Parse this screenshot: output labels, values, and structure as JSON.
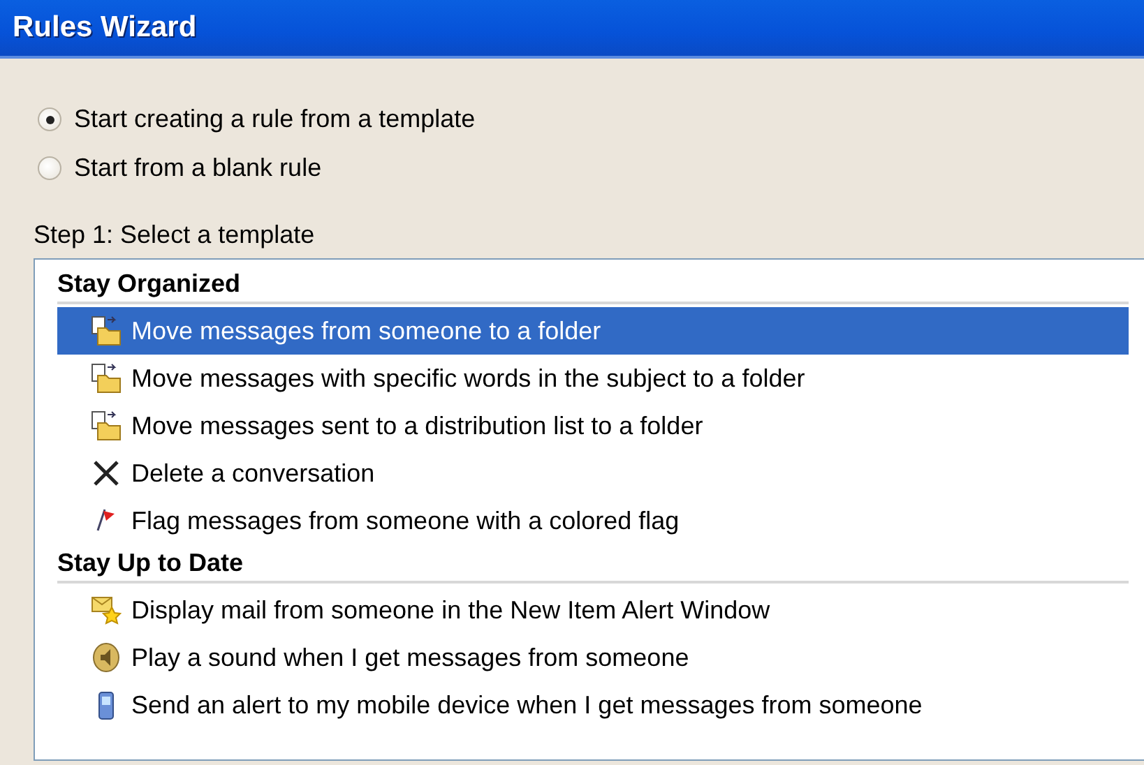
{
  "window": {
    "title": "Rules Wizard"
  },
  "start_options": [
    {
      "label": "Start creating a rule from a template",
      "selected": true
    },
    {
      "label": "Start from a blank rule",
      "selected": false
    }
  ],
  "step_label": "Step 1: Select a template",
  "template_groups": [
    {
      "heading": "Stay Organized",
      "items": [
        {
          "label": "Move messages from someone to a folder",
          "kind": "move",
          "selected": true
        },
        {
          "label": "Move messages with specific words in the subject to a folder",
          "kind": "move",
          "selected": false
        },
        {
          "label": "Move messages sent to a distribution list to a folder",
          "kind": "move",
          "selected": false
        },
        {
          "label": "Delete a conversation",
          "kind": "delete",
          "selected": false
        },
        {
          "label": "Flag messages from someone with a colored flag",
          "kind": "flag",
          "selected": false
        }
      ]
    },
    {
      "heading": "Stay Up to Date",
      "items": [
        {
          "label": "Display mail from someone in the New Item Alert Window",
          "kind": "alert",
          "selected": false
        },
        {
          "label": "Play a sound when I get messages from someone",
          "kind": "sound",
          "selected": false
        },
        {
          "label": "Send an alert to my mobile device when I get messages from someone",
          "kind": "mobile",
          "selected": false
        }
      ]
    }
  ]
}
